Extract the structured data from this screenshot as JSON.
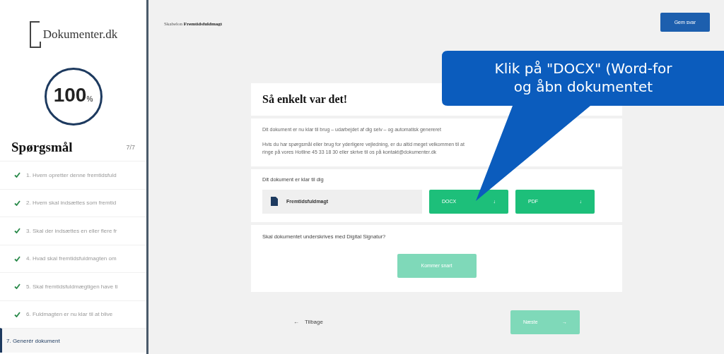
{
  "sidebar": {
    "logo": "Dokumenter.dk",
    "progress": {
      "value": "100",
      "unit": "%"
    },
    "heading": "Spørgsmål",
    "counter": "7/7",
    "items": [
      {
        "label": "1. Hvem opretter denne fremtidsfuld",
        "done": true,
        "selected": false
      },
      {
        "label": "2. Hvem skal indsættes som fremtid",
        "done": true,
        "selected": false
      },
      {
        "label": "3. Skal der indsættes en eller flere fr",
        "done": true,
        "selected": false
      },
      {
        "label": "4. Hvad skal fremtidsfuldmagten om",
        "done": true,
        "selected": false
      },
      {
        "label": "5. Skal fremtidsfuldmægtigen have ti",
        "done": true,
        "selected": false
      },
      {
        "label": "6. Fuldmagten er nu klar til at blive",
        "done": true,
        "selected": false
      },
      {
        "label": "7. Generér dokument",
        "done": false,
        "selected": true
      }
    ]
  },
  "breadcrumb": {
    "prefix": "Skabelon",
    "current": "Fremtidsfuldmagt"
  },
  "save_button": "Gem svar",
  "card": {
    "title": "Så enkelt var det!",
    "intro": [
      "Dit dokument er nu klar til brug – udarbejdet af dig selv – og automatisk genereret",
      "Hvis du har spørgsmål eller brug for yderligere vejledning, er du altid meget velkommen til at ringe på vores Hotline 45 33 18 30 eller skrive til os på kontakt@dokumenter.dk"
    ],
    "download_label": "Dit dokument er klar til dig",
    "file_name": "Fremtidsfuldmagt",
    "downloads": [
      {
        "label": "DOCX",
        "arrow": "↓"
      },
      {
        "label": "PDF",
        "arrow": "↓"
      }
    ],
    "signature_question": "Skal dokumentet underskrives med Digital Signatur?",
    "signature_button": {
      "label": "Kommer snart",
      "disabled": true
    }
  },
  "nav": {
    "back": {
      "arrow": "←",
      "label": "Tilbage"
    },
    "next": {
      "label": "Næste",
      "arrow": "→",
      "disabled": true
    }
  },
  "callout": {
    "lines": [
      "Klik på \"DOCX\" (Word-for",
      "og åbn dokumentet"
    ]
  }
}
